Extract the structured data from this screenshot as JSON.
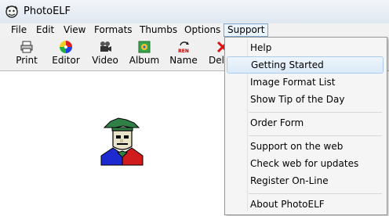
{
  "window": {
    "title": "PhotoELF"
  },
  "menubar": {
    "items": [
      "File",
      "Edit",
      "View",
      "Formats",
      "Thumbs",
      "Options",
      "Support"
    ],
    "open_menu": "Support"
  },
  "toolbar": {
    "buttons": [
      {
        "label": "Print",
        "icon": "printer-icon"
      },
      {
        "label": "Editor",
        "icon": "color-wheel-icon"
      },
      {
        "label": "Video",
        "icon": "video-camera-icon"
      },
      {
        "label": "Album",
        "icon": "album-icon"
      },
      {
        "label": "Name",
        "icon": "rename-icon",
        "icon_text": "REN"
      },
      {
        "label": "Del",
        "icon": "delete-x-icon"
      }
    ]
  },
  "support_menu": {
    "items": [
      "Help",
      "Getting Started",
      "Image Format List",
      "Show Tip of the Day",
      "Order Form",
      "Support on the web",
      "Check web for updates",
      "Register On-Line",
      "About PhotoELF"
    ],
    "highlighted": "Getting Started"
  },
  "canvas": {
    "image": "elf-mascot-icon"
  },
  "colors": {
    "menu_highlight": "#dbeaf8",
    "open_menu_border": "#7ea7cf"
  }
}
